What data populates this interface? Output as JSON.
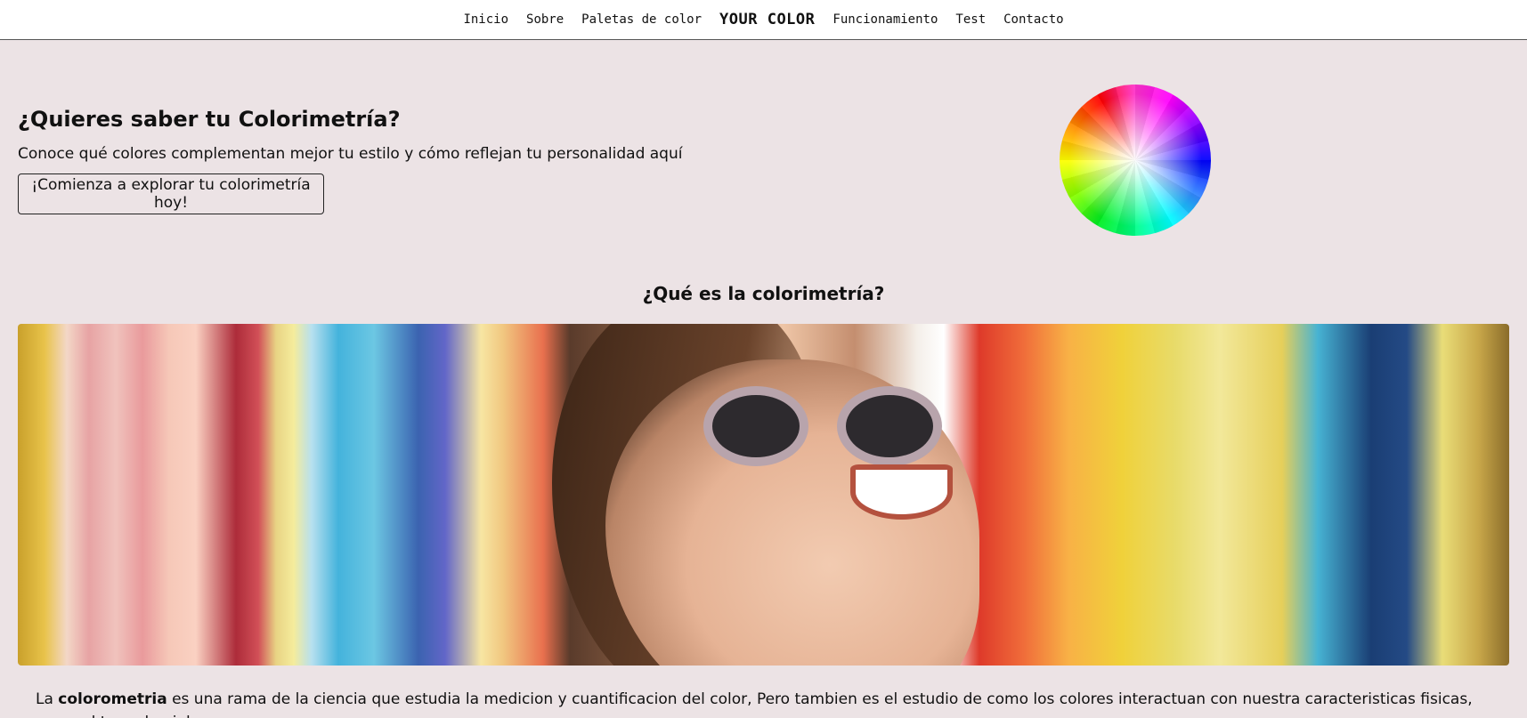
{
  "nav": {
    "items": [
      "Inicio",
      "Sobre",
      "Paletas de color",
      "YOUR COLOR",
      "Funcionamiento",
      "Test",
      "Contacto"
    ]
  },
  "hero": {
    "title": "¿Quieres saber tu Colorimetría?",
    "subtitle": "Conoce qué colores complementan mejor tu estilo y cómo reflejan tu personalidad aquí",
    "cta_label": "¡Comienza a explorar tu colorimetría hoy!"
  },
  "section": {
    "title": "¿Qué es la colorimetría?",
    "paragraph_prefix": "La ",
    "paragraph_bold": "colorometria",
    "paragraph_rest": " es una rama de la ciencia que estudia la medicion y cuantificacion del color, Pero tambien es el estudio de como los colores interactuan con nuestra caracteristicas fisicas, como el tono de piel,"
  },
  "colors": {
    "background": "#ece3e5",
    "nav_background": "#ffffff"
  }
}
